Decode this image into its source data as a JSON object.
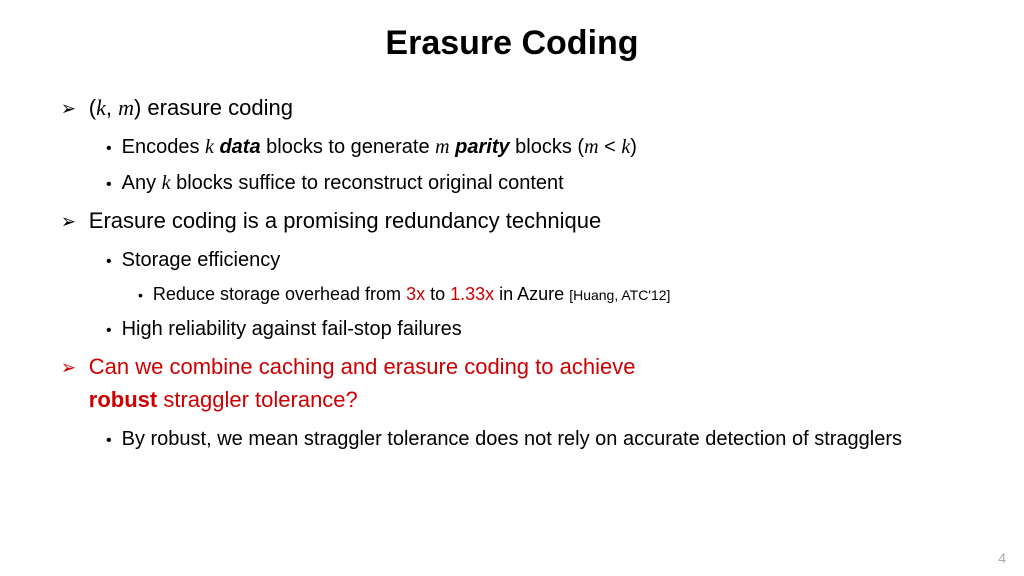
{
  "title": "Erasure Coding",
  "page_number": "4",
  "sections": {
    "s1": {
      "km_head_open": "(",
      "k": "k",
      "comma": ", ",
      "m": "m",
      "km_head_close": ") erasure coding",
      "sub1_prefix": "Encodes ",
      "sub1_data": "data",
      "sub1_mid": " blocks to generate ",
      "sub1_parity": "parity",
      "sub1_tail": " blocks (",
      "sub1_lt": " < ",
      "sub1_close": ")",
      "sub2_prefix": "Any ",
      "sub2_tail": " blocks suffice to reconstruct original content"
    },
    "s2": {
      "head": "Erasure coding is a promising redundancy technique",
      "sub1": "Storage efficiency",
      "sub1a_prefix": "Reduce storage overhead from ",
      "sub1a_3x": "3x",
      "sub1a_mid": " to ",
      "sub1a_133x": "1.33x",
      "sub1a_tail": " in Azure ",
      "sub1a_cite": "[Huang, ATC'12]",
      "sub2": "High reliability against fail-stop failures"
    },
    "s3": {
      "line1": "Can we combine caching and erasure coding to achieve",
      "line2_bold": "robust",
      "line2_tail": " straggler tolerance?",
      "sub1": "By robust, we mean straggler tolerance does not rely on accurate detection of stragglers"
    }
  }
}
